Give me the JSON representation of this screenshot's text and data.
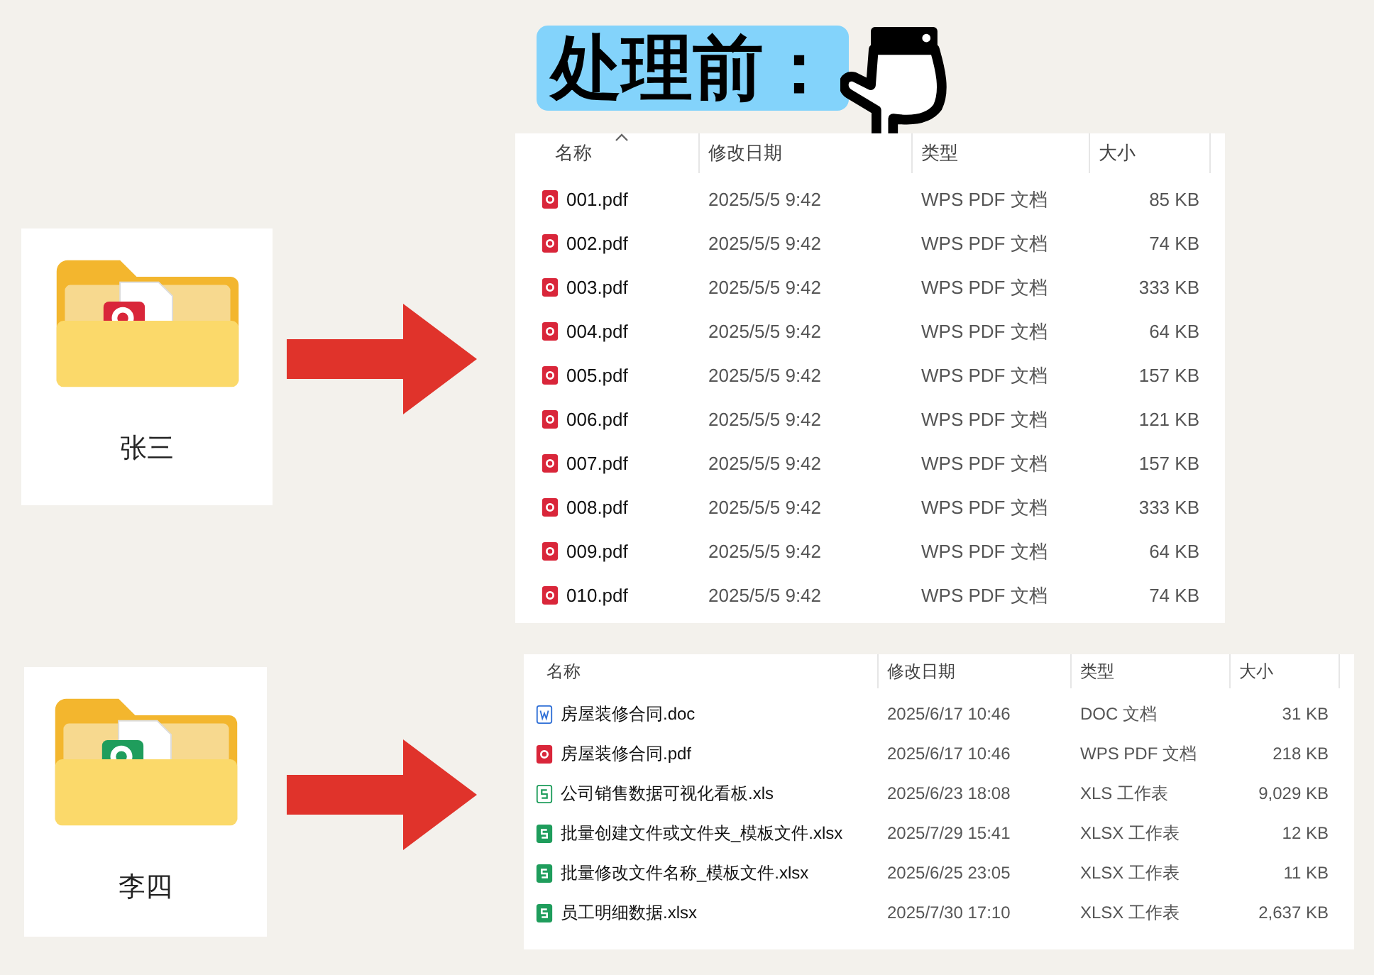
{
  "title": "处理前：",
  "groups": [
    {
      "folder": {
        "name": "张三",
        "kind": "pdf"
      },
      "columns": [
        {
          "label": "名称",
          "sorted": true
        },
        {
          "label": "修改日期",
          "sorted": false
        },
        {
          "label": "类型",
          "sorted": false
        },
        {
          "label": "大小",
          "sorted": false
        }
      ],
      "rows": [
        {
          "kind": "pdf",
          "name": "001.pdf",
          "date": "2025/5/5 9:42",
          "type": "WPS PDF 文档",
          "size": "85 KB"
        },
        {
          "kind": "pdf",
          "name": "002.pdf",
          "date": "2025/5/5 9:42",
          "type": "WPS PDF 文档",
          "size": "74 KB"
        },
        {
          "kind": "pdf",
          "name": "003.pdf",
          "date": "2025/5/5 9:42",
          "type": "WPS PDF 文档",
          "size": "333 KB"
        },
        {
          "kind": "pdf",
          "name": "004.pdf",
          "date": "2025/5/5 9:42",
          "type": "WPS PDF 文档",
          "size": "64 KB"
        },
        {
          "kind": "pdf",
          "name": "005.pdf",
          "date": "2025/5/5 9:42",
          "type": "WPS PDF 文档",
          "size": "157 KB"
        },
        {
          "kind": "pdf",
          "name": "006.pdf",
          "date": "2025/5/5 9:42",
          "type": "WPS PDF 文档",
          "size": "121 KB"
        },
        {
          "kind": "pdf",
          "name": "007.pdf",
          "date": "2025/5/5 9:42",
          "type": "WPS PDF 文档",
          "size": "157 KB"
        },
        {
          "kind": "pdf",
          "name": "008.pdf",
          "date": "2025/5/5 9:42",
          "type": "WPS PDF 文档",
          "size": "333 KB"
        },
        {
          "kind": "pdf",
          "name": "009.pdf",
          "date": "2025/5/5 9:42",
          "type": "WPS PDF 文档",
          "size": "64 KB"
        },
        {
          "kind": "pdf",
          "name": "010.pdf",
          "date": "2025/5/5 9:42",
          "type": "WPS PDF 文档",
          "size": "74 KB"
        }
      ]
    },
    {
      "folder": {
        "name": "李四",
        "kind": "xlsx"
      },
      "columns": [
        {
          "label": "名称",
          "sorted": false
        },
        {
          "label": "修改日期",
          "sorted": false
        },
        {
          "label": "类型",
          "sorted": false
        },
        {
          "label": "大小",
          "sorted": false
        }
      ],
      "rows": [
        {
          "kind": "doc",
          "name": "房屋装修合同.doc",
          "date": "2025/6/17 10:46",
          "type": "DOC 文档",
          "size": "31 KB"
        },
        {
          "kind": "pdf",
          "name": "房屋装修合同.pdf",
          "date": "2025/6/17 10:46",
          "type": "WPS PDF 文档",
          "size": "218 KB"
        },
        {
          "kind": "xls",
          "name": "公司销售数据可视化看板.xls",
          "date": "2025/6/23 18:08",
          "type": "XLS 工作表",
          "size": "9,029 KB"
        },
        {
          "kind": "xlsx",
          "name": "批量创建文件或文件夹_模板文件.xlsx",
          "date": "2025/7/29 15:41",
          "type": "XLSX 工作表",
          "size": "12 KB"
        },
        {
          "kind": "xlsx",
          "name": "批量修改文件名称_模板文件.xlsx",
          "date": "2025/6/25 23:05",
          "type": "XLSX 工作表",
          "size": "11 KB"
        },
        {
          "kind": "xlsx",
          "name": "员工明细数据.xlsx",
          "date": "2025/7/30 17:10",
          "type": "XLSX 工作表",
          "size": "2,637 KB"
        }
      ]
    }
  ]
}
